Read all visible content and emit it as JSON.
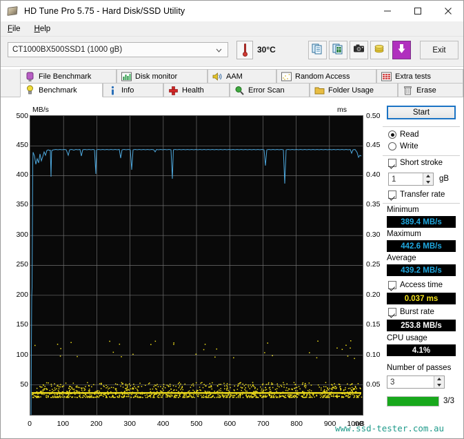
{
  "window": {
    "title": "HD Tune Pro 5.75 - Hard Disk/SSD Utility",
    "icon": "hard-disk-icon",
    "minimize": "–",
    "maximize": "□",
    "close": "✕"
  },
  "menu": {
    "items": [
      {
        "label": "File",
        "mnemonic": "F"
      },
      {
        "label": "Help",
        "mnemonic": "H"
      }
    ]
  },
  "toolbar": {
    "drive": "CT1000BX500SSD1 (1000 gB)",
    "dropdown_icon": "chevron-down-icon",
    "temperature_icon": "thermometer-icon",
    "temperature": "30°C",
    "buttons": [
      {
        "name": "copy-to-clipboard-button",
        "icon": "document-copy-icon"
      },
      {
        "name": "export-to-excel-button",
        "icon": "spreadsheet-export-icon"
      },
      {
        "name": "screenshot-button",
        "icon": "camera-icon"
      },
      {
        "name": "donate-button",
        "icon": "coins-icon"
      },
      {
        "name": "download-button",
        "icon": "download-arrow-icon"
      }
    ],
    "exit_label": "Exit"
  },
  "tabs": {
    "row1": [
      {
        "label": "File Benchmark",
        "icon": "purple-bulb-icon",
        "active": false
      },
      {
        "label": "Disk monitor",
        "icon": "bar-chart-icon",
        "active": false
      },
      {
        "label": "AAM",
        "icon": "speaker-icon",
        "active": false
      },
      {
        "label": "Random Access",
        "icon": "random-dots-icon",
        "active": false
      },
      {
        "label": "Extra tests",
        "icon": "extra-chart-icon",
        "active": false
      }
    ],
    "row2": [
      {
        "label": "Benchmark",
        "icon": "yellow-bulb-icon",
        "active": true
      },
      {
        "label": "Info",
        "icon": "info-icon",
        "active": false
      },
      {
        "label": "Health",
        "icon": "red-cross-icon",
        "active": false
      },
      {
        "label": "Error Scan",
        "icon": "magnifier-icon",
        "active": false
      },
      {
        "label": "Folder Usage",
        "icon": "folder-icon",
        "active": false
      },
      {
        "label": "Erase",
        "icon": "trash-icon",
        "active": false
      }
    ]
  },
  "panel": {
    "start_label": "Start",
    "mode": {
      "read_label": "Read",
      "write_label": "Write",
      "selected": "Read"
    },
    "short_stroke": {
      "label": "Short stroke",
      "checked": true,
      "value": "1",
      "unit": "gB"
    },
    "transfer_rate": {
      "label": "Transfer rate",
      "checked": true
    },
    "minimum": {
      "label": "Minimum",
      "value": "389.4 MB/s"
    },
    "maximum": {
      "label": "Maximum",
      "value": "442.6 MB/s"
    },
    "average": {
      "label": "Average",
      "value": "439.2 MB/s"
    },
    "access_time": {
      "label": "Access time",
      "checked": true,
      "value": "0.037 ms"
    },
    "burst_rate": {
      "label": "Burst rate",
      "checked": true,
      "value": "253.8 MB/s"
    },
    "cpu_usage": {
      "label": "CPU usage",
      "value": "4.1%"
    },
    "passes": {
      "label": "Number of passes",
      "value": "3"
    },
    "progress": {
      "percent": 100,
      "text": "3/3"
    }
  },
  "watermark": "www.ssd-tester.com.au",
  "chart_data": {
    "type": "line",
    "title": "",
    "xlabel": "",
    "ylabel": "MB/s",
    "y2label": "ms",
    "xunit": "mB",
    "xlim": [
      0,
      1000
    ],
    "ylim": [
      0,
      500
    ],
    "y2lim": [
      0,
      0.5
    ],
    "grid": true,
    "legend_position": "none",
    "xticks": [
      0,
      100,
      200,
      300,
      400,
      500,
      600,
      700,
      800,
      900,
      1000
    ],
    "yticks": [
      0,
      50,
      100,
      150,
      200,
      250,
      300,
      350,
      400,
      450,
      500
    ],
    "y2ticks": [
      "0.05",
      "0.10",
      "0.15",
      "0.20",
      "0.25",
      "0.30",
      "0.35",
      "0.40",
      "0.45",
      "0.50"
    ],
    "series": [
      {
        "name": "Transfer rate",
        "type": "line",
        "color": "#4ea8dd",
        "axis": "left",
        "units": "MB/s",
        "x": [
          0,
          5,
          10,
          15,
          20,
          25,
          30,
          35,
          40,
          45,
          50,
          60,
          70,
          80,
          90,
          100,
          110,
          118,
          125,
          135,
          145,
          155,
          165,
          175,
          185,
          195,
          205,
          215,
          225,
          235,
          245,
          255,
          265,
          272,
          280,
          290,
          300,
          310,
          320,
          330,
          340,
          350,
          360,
          370,
          380,
          390,
          400,
          410,
          420,
          430,
          440,
          450,
          460,
          470,
          480,
          490,
          500,
          510,
          520,
          530,
          540,
          550,
          560,
          570,
          580,
          590,
          600,
          610,
          620,
          630,
          640,
          650,
          660,
          670,
          680,
          690,
          700,
          710,
          720,
          730,
          740,
          750,
          760,
          770,
          780,
          790,
          800,
          810,
          820,
          830,
          840,
          850,
          860,
          870,
          880,
          890,
          900,
          910,
          920,
          930,
          940,
          950,
          960,
          970,
          980,
          990,
          1000
        ],
        "y": [
          389.4,
          392,
          420,
          431,
          425,
          435,
          428,
          438,
          433,
          440,
          430,
          441,
          442,
          441,
          436,
          441,
          442,
          441,
          440,
          442,
          441,
          440,
          442,
          441,
          408,
          441,
          441,
          442,
          440,
          441,
          442,
          441,
          440,
          410,
          441,
          442,
          441,
          441,
          442,
          440,
          441,
          441,
          442,
          440,
          441,
          442,
          441,
          440,
          441,
          442,
          441,
          440,
          442,
          441,
          440,
          441,
          442,
          441,
          440,
          442,
          441,
          441,
          442,
          441,
          440,
          441,
          442,
          441,
          440,
          441,
          442,
          441,
          440,
          442,
          441,
          441,
          442,
          440,
          441,
          442,
          441,
          440,
          441,
          442,
          441,
          440,
          441,
          442,
          441,
          440,
          441,
          442,
          441,
          440,
          441,
          442,
          441,
          440,
          441,
          442,
          441,
          440,
          441,
          442,
          441,
          440,
          437
        ],
        "dips_to": [
          389.4,
          408,
          410,
          405,
          412,
          409,
          403,
          411
        ]
      },
      {
        "name": "Access time",
        "type": "scatter",
        "color": "#f2e01c",
        "axis": "right",
        "units": "ms",
        "typical_value": 0.037,
        "scatter_band_ms": [
          0.03,
          0.055
        ],
        "outlier_band_ms": [
          0.095,
          0.125
        ]
      }
    ]
  }
}
